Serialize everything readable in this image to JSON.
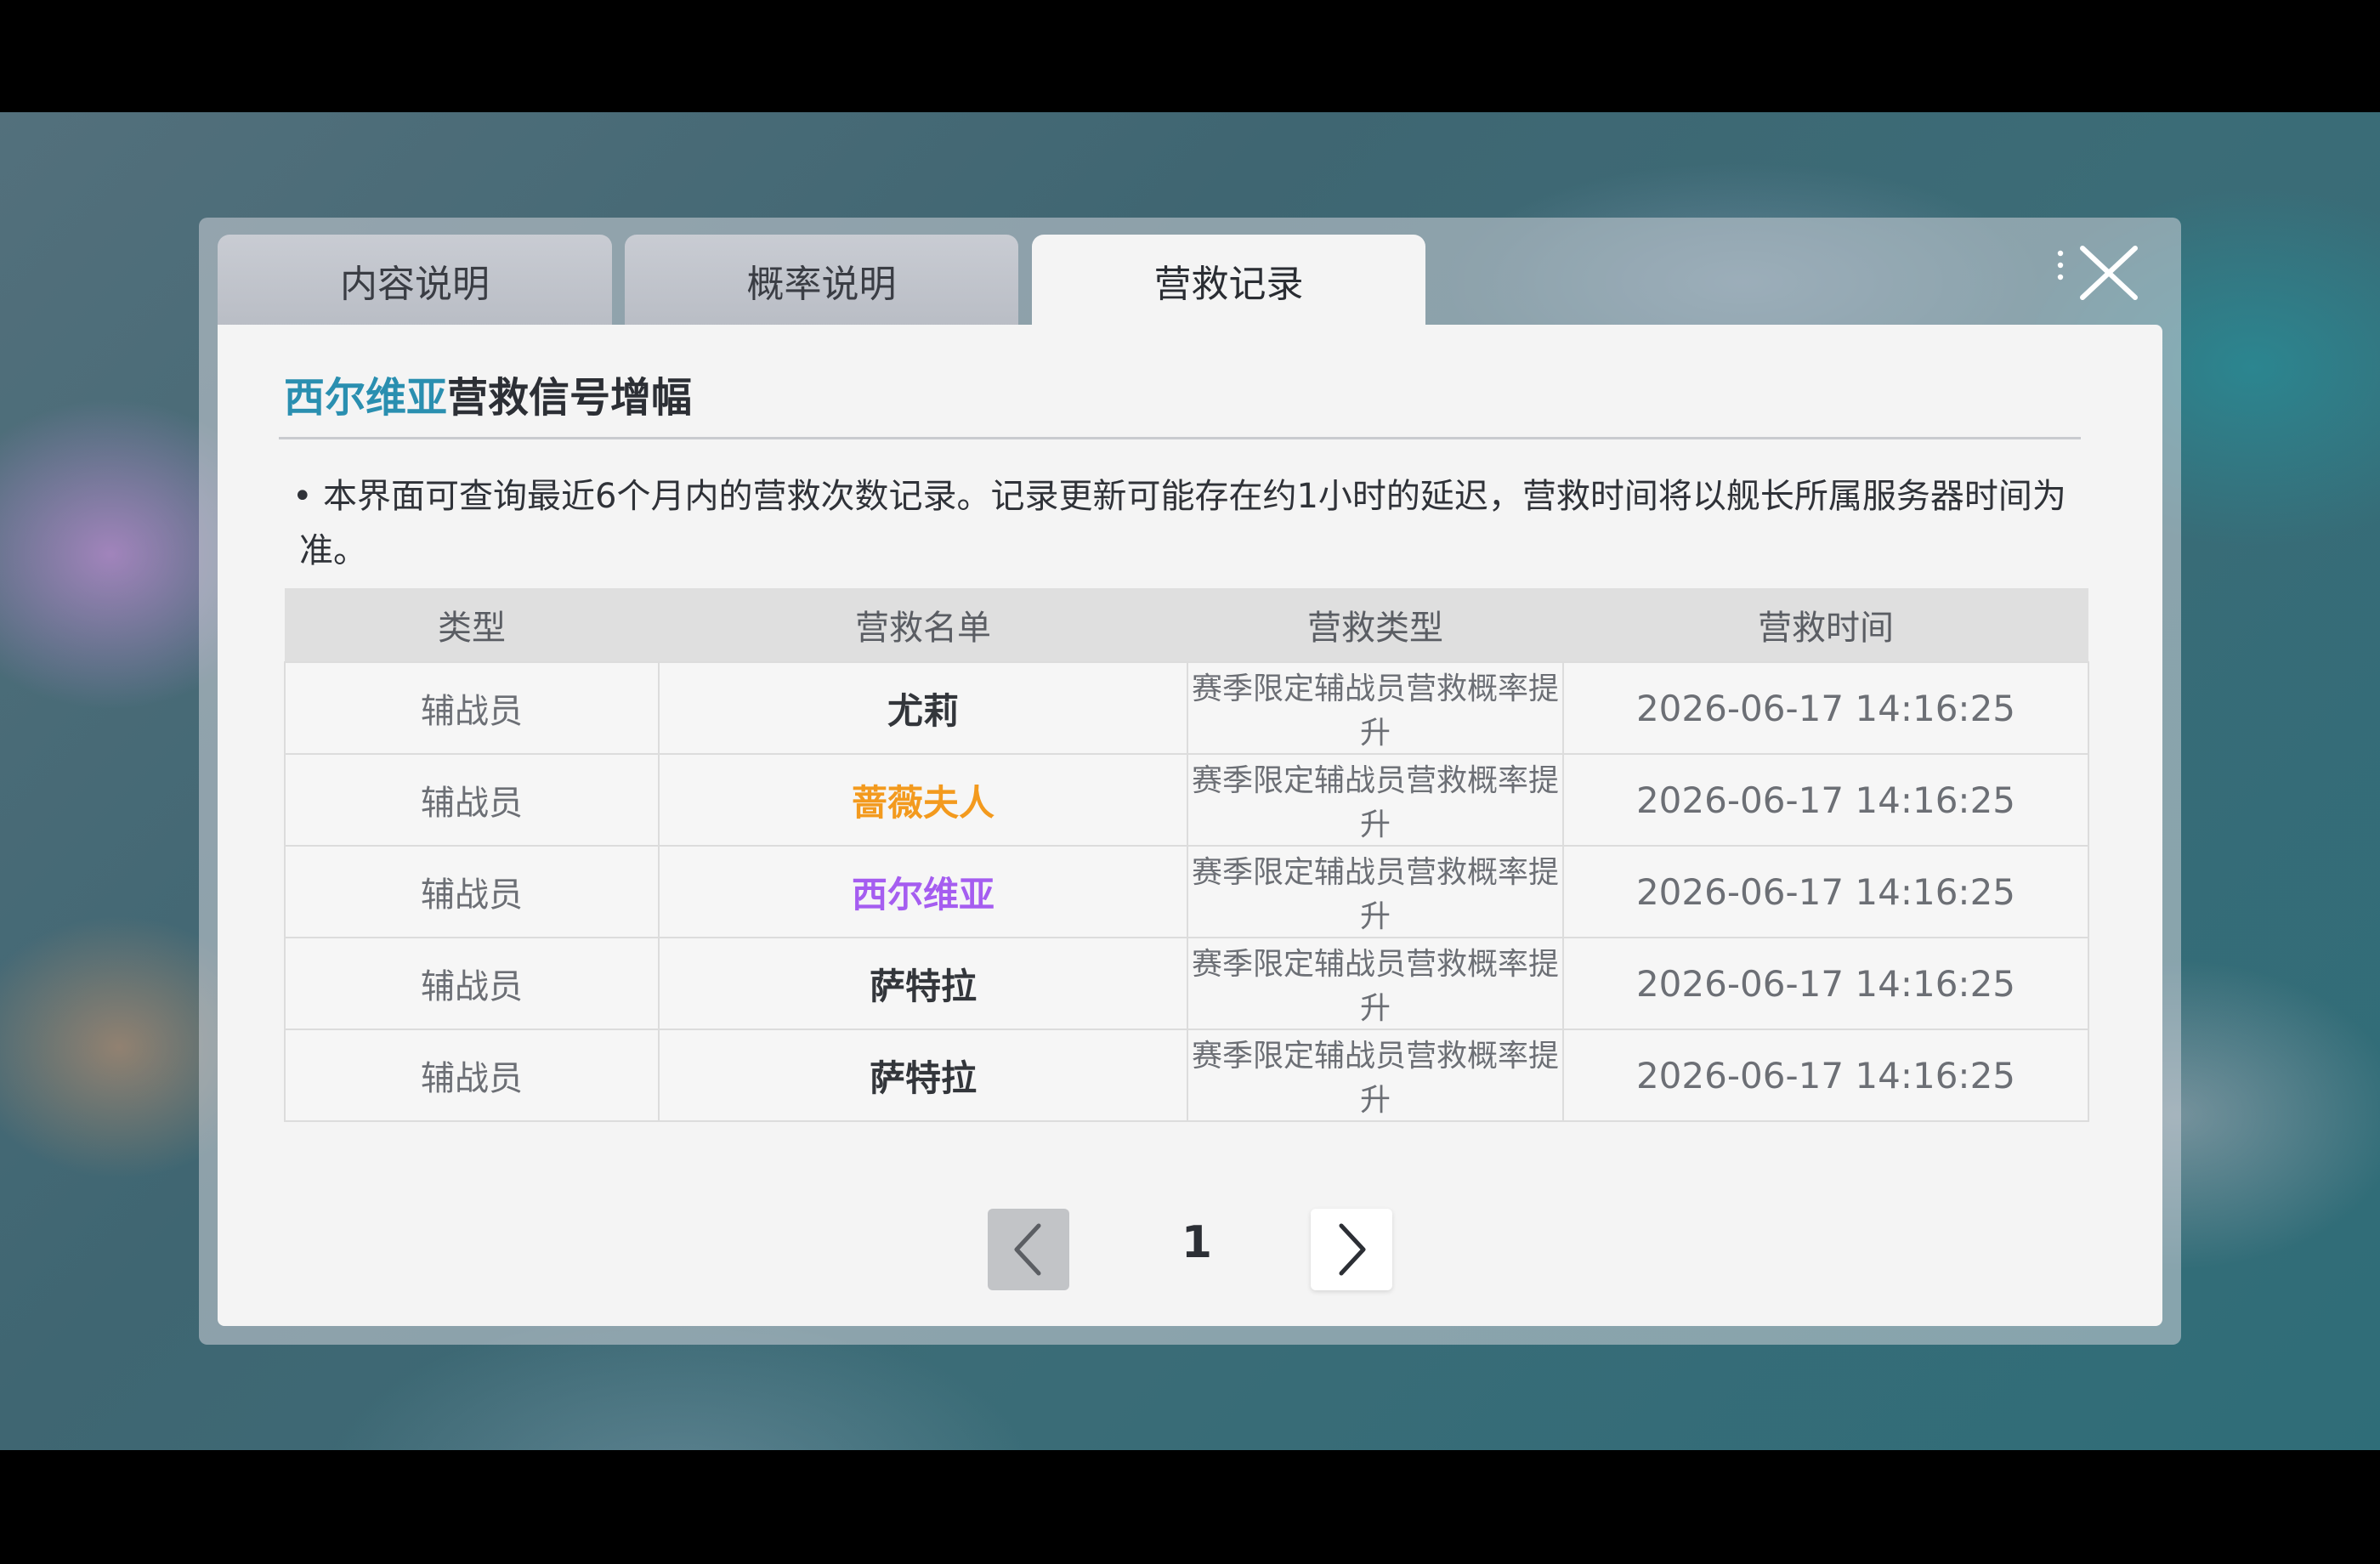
{
  "tabs": [
    {
      "label": "内容说明",
      "active": false
    },
    {
      "label": "概率说明",
      "active": false
    },
    {
      "label": "营救记录",
      "active": true
    }
  ],
  "heading": {
    "accent": "西尔维亚",
    "rest": "营救信号增幅"
  },
  "note": "本界面可查询最近6个月内的营救次数记录。记录更新可能存在约1小时的延迟，营救时间将以舰长所属服务器时间为准。",
  "table": {
    "headers": [
      "类型",
      "营救名单",
      "营救类型",
      "营救时间"
    ],
    "rows": [
      {
        "type": "辅战员",
        "name": "尤莉",
        "name_color": "#33363b",
        "rescue_type": "赛季限定辅战员营救概率提升",
        "time": "2026-06-17 14:16:25"
      },
      {
        "type": "辅战员",
        "name": "蔷薇夫人",
        "name_color": "#f39a1e",
        "rescue_type": "赛季限定辅战员营救概率提升",
        "time": "2026-06-17 14:16:25"
      },
      {
        "type": "辅战员",
        "name": "西尔维亚",
        "name_color": "#a55df0",
        "rescue_type": "赛季限定辅战员营救概率提升",
        "time": "2026-06-17 14:16:25"
      },
      {
        "type": "辅战员",
        "name": "萨特拉",
        "name_color": "#33363b",
        "rescue_type": "赛季限定辅战员营救概率提升",
        "time": "2026-06-17 14:16:25"
      },
      {
        "type": "辅战员",
        "name": "萨特拉",
        "name_color": "#33363b",
        "rescue_type": "赛季限定辅战员营救概率提升",
        "time": "2026-06-17 14:16:25"
      }
    ]
  },
  "pager": {
    "current_page": "1",
    "prev_icon": "chevron-left-icon",
    "next_icon": "chevron-right-icon"
  },
  "colors": {
    "accent": "#2a8fb0",
    "panel": "#f4f4f4"
  },
  "close_icon": "close-icon"
}
